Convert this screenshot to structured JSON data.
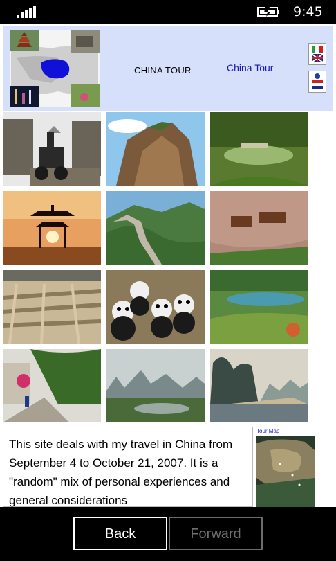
{
  "status_bar": {
    "time": "9:45"
  },
  "header": {
    "title": "CHINA TOUR",
    "link_text": "China Tour"
  },
  "intro": {
    "text": "This site deals with my travel in China from September 4 to October 21, 2007. It is a \"random\" mix of personal experiences and general considerations"
  },
  "sidebar": {
    "map_label": "Tour Map"
  },
  "app_bar": {
    "back_label": "Back",
    "forward_label": "Forward"
  },
  "colors": {
    "header_bg": "#d6e0fb",
    "link": "#1a1ab5",
    "disabled": "#6d6d6d"
  }
}
